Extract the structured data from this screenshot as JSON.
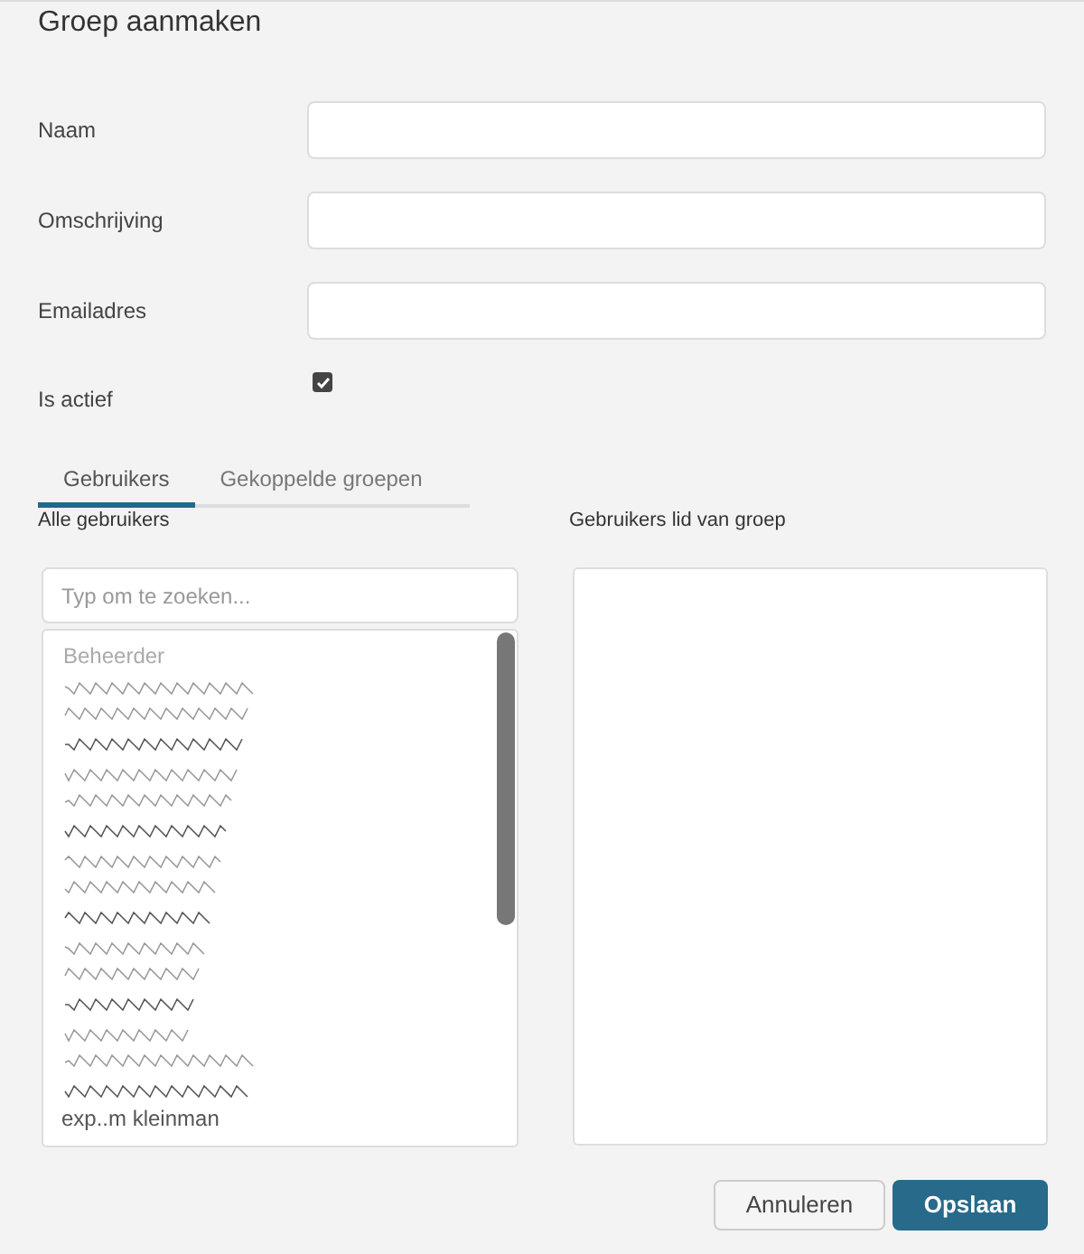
{
  "title": "Groep aanmaken",
  "fields": [
    {
      "label": "Naam"
    },
    {
      "label": "Omschrijving"
    },
    {
      "label": "Emailadres"
    }
  ],
  "active": {
    "label": "Is actief",
    "checked": true
  },
  "tabs": [
    {
      "label": "Gebruikers",
      "selected": true
    },
    {
      "label": "Gekoppelde groepen",
      "selected": false
    }
  ],
  "all_users": {
    "heading": "Alle gebruikers",
    "search": {
      "placeholder": "Typ om te zoeken..."
    },
    "items": [
      {
        "kind": "group",
        "text": "Beheerder"
      },
      {
        "kind": "redacted"
      },
      {
        "kind": "redacted"
      },
      {
        "kind": "redacted"
      },
      {
        "kind": "redacted"
      },
      {
        "kind": "redacted"
      },
      {
        "kind": "redacted"
      },
      {
        "kind": "redacted"
      },
      {
        "kind": "redacted"
      },
      {
        "kind": "redacted"
      },
      {
        "kind": "redacted"
      },
      {
        "kind": "redacted"
      },
      {
        "kind": "redacted"
      },
      {
        "kind": "redacted"
      },
      {
        "kind": "redacted"
      },
      {
        "kind": "redacted"
      },
      {
        "kind": "user",
        "text": "exp..m kleinman"
      }
    ]
  },
  "members": {
    "heading": "Gebruikers lid van groep"
  },
  "buttons": [
    {
      "label": "Annuleren",
      "kind": "secondary"
    },
    {
      "label": "Opslaan",
      "kind": "primary"
    }
  ]
}
